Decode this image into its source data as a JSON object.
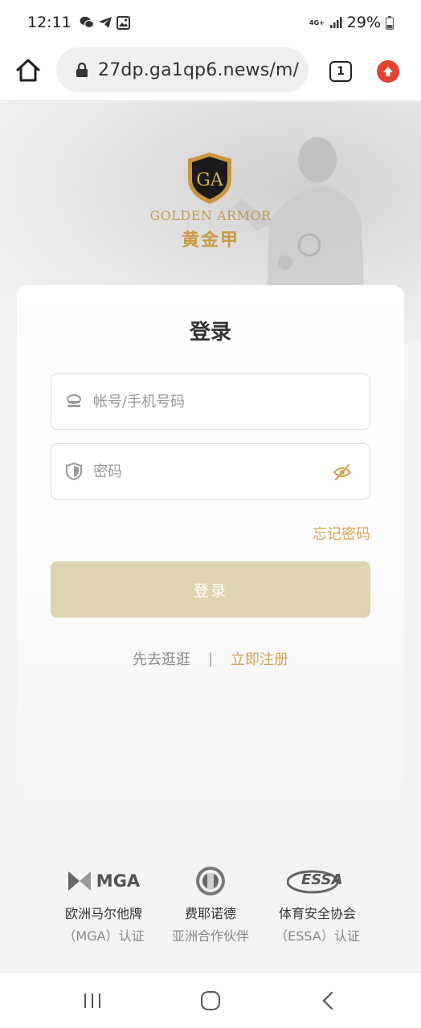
{
  "status_bar": {
    "time": "12:11",
    "notification_icons": [
      "wechat-icon",
      "telegram-icon",
      "gallery-icon"
    ],
    "network": "4G+",
    "battery": "29%"
  },
  "browser": {
    "url": "27dp.ga1qp6.news/m/",
    "tab_count": "1"
  },
  "brand": {
    "logo_name_en": "GOLDEN ARMOR",
    "logo_name_cn": "黄金甲",
    "logo_monogram": "GA"
  },
  "login": {
    "title": "登录",
    "account_placeholder": "帐号/手机号码",
    "password_placeholder": "密码",
    "forgot_label": "忘记密码",
    "submit_label": "登录",
    "browse_label": "先去逛逛",
    "separator": "|",
    "register_label": "立即注册"
  },
  "partners": [
    {
      "logo_text": "MGA",
      "name": "欧洲马尔他牌",
      "sub": "（MGA）认证"
    },
    {
      "logo_text": "",
      "name": "费耶诺德",
      "sub": "亚洲合作伙伴"
    },
    {
      "logo_text": "ESSA",
      "name": "体育安全协会",
      "sub": "（ESSA）认证"
    }
  ],
  "colors": {
    "accent_gold": "#d4a254",
    "button_disabled": "#dfd4b1",
    "update_red": "#e34234"
  }
}
